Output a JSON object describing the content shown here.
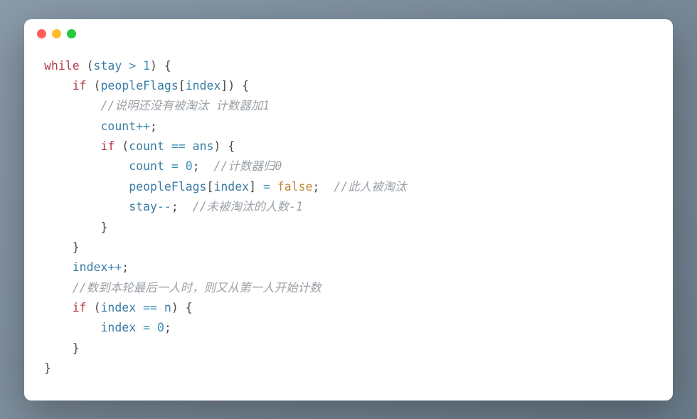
{
  "titlebar": {
    "buttons": [
      "close",
      "minimize",
      "maximize"
    ]
  },
  "code": {
    "l1": {
      "kw": "while",
      "sp": " ",
      "p1": "(",
      "v1": "stay",
      "op": " > ",
      "n1": "1",
      "p2": ")",
      "sp2": " ",
      "br": "{"
    },
    "l2": {
      "indent": "    ",
      "kw": "if",
      "sp": " ",
      "p1": "(",
      "v1": "peopleFlags",
      "bk1": "[",
      "v2": "index",
      "bk2": "]",
      "p2": ")",
      "sp2": " ",
      "br": "{"
    },
    "l3": {
      "indent": "        ",
      "c": "//说明还没有被淘汰 计数器加1"
    },
    "l4": {
      "indent": "        ",
      "v1": "count",
      "op": "++",
      "sc": ";"
    },
    "l5": {
      "indent": "        ",
      "kw": "if",
      "sp": " ",
      "p1": "(",
      "v1": "count",
      "op": " == ",
      "v2": "ans",
      "p2": ")",
      "sp2": " ",
      "br": "{"
    },
    "l6": {
      "indent": "            ",
      "v1": "count",
      "op": " = ",
      "n1": "0",
      "sc": ";",
      "sp": "  ",
      "c": "//计数器归0"
    },
    "l7": {
      "indent": "            ",
      "v1": "peopleFlags",
      "bk1": "[",
      "v2": "index",
      "bk2": "]",
      "op": " = ",
      "b1": "false",
      "sc": ";",
      "sp": "  ",
      "c": "//此人被淘汰"
    },
    "l8": {
      "indent": "            ",
      "v1": "stay",
      "op": "--",
      "sc": ";",
      "sp": "  ",
      "c": "//未被淘汰的人数-1"
    },
    "l9": {
      "indent": "        ",
      "br": "}"
    },
    "l10": {
      "indent": "    ",
      "br": "}"
    },
    "l11": {
      "indent": "    ",
      "v1": "index",
      "op": "++",
      "sc": ";"
    },
    "l12": {
      "indent": "    ",
      "c": "//数到本轮最后一人时，则又从第一人开始计数"
    },
    "l13": {
      "indent": "    ",
      "kw": "if",
      "sp": " ",
      "p1": "(",
      "v1": "index",
      "op": " == ",
      "v2": "n",
      "p2": ")",
      "sp2": " ",
      "br": "{"
    },
    "l14": {
      "indent": "        ",
      "v1": "index",
      "op": " = ",
      "n1": "0",
      "sc": ";"
    },
    "l15": {
      "indent": "    ",
      "br": "}"
    },
    "l16": {
      "br": "}"
    }
  }
}
